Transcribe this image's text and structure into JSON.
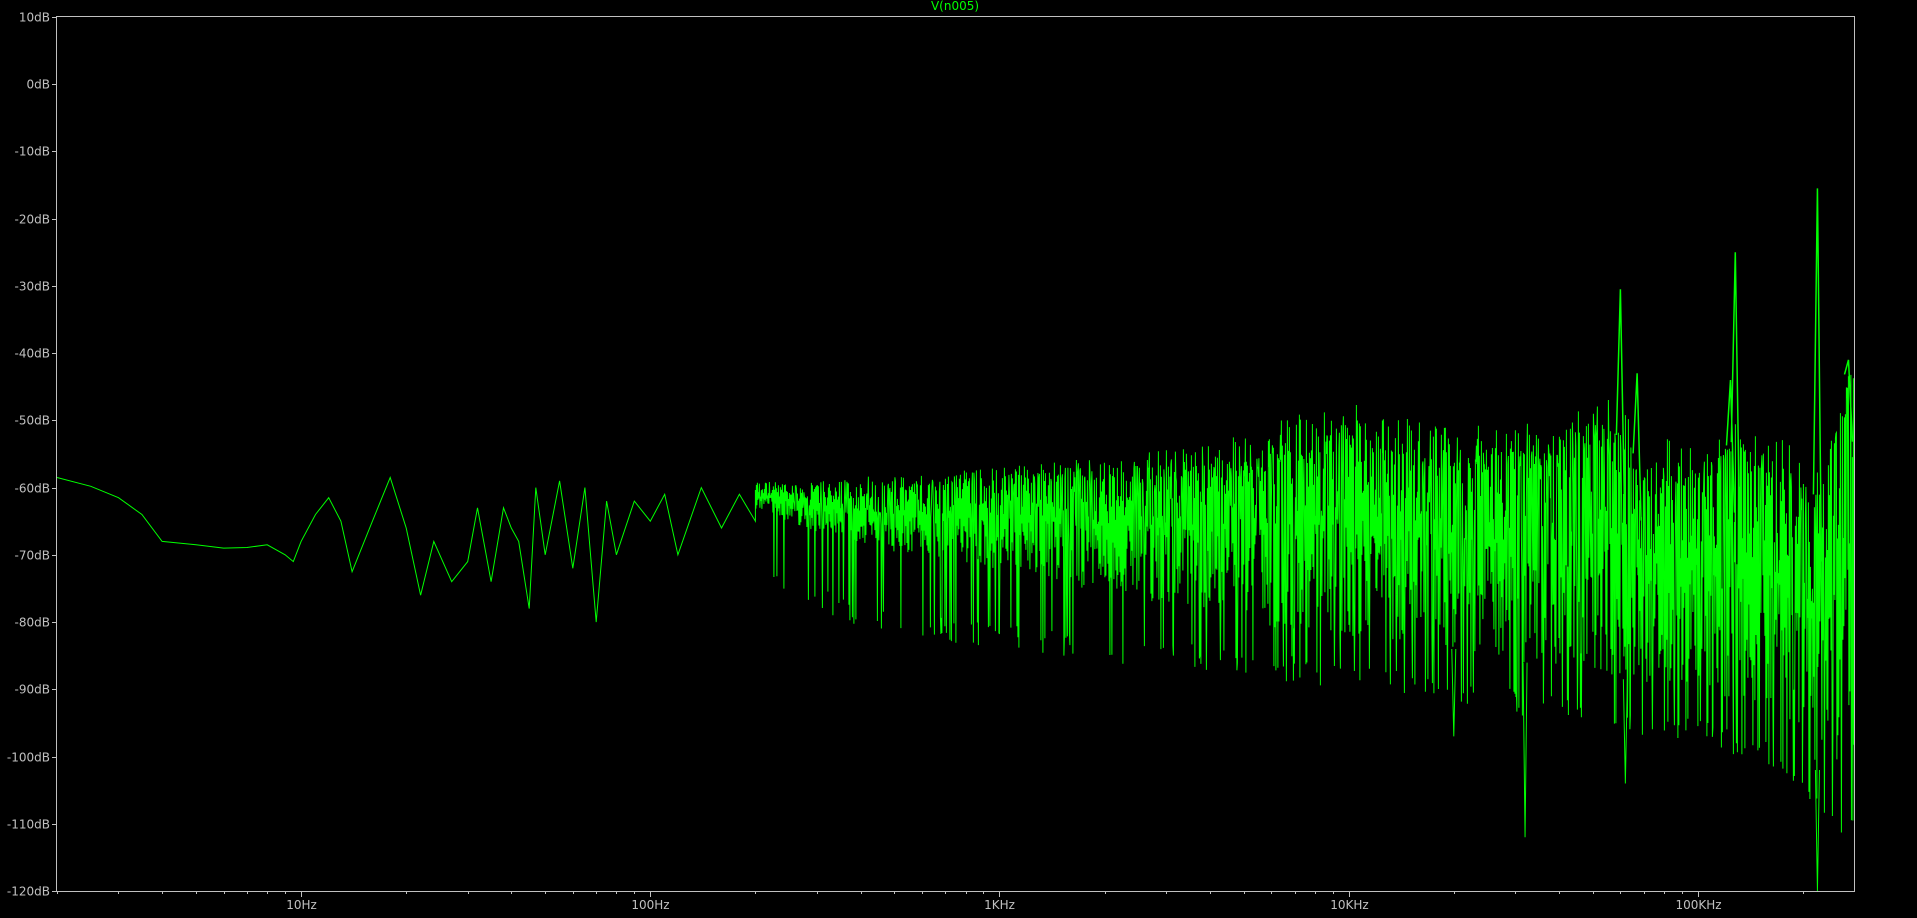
{
  "chart_data": {
    "type": "line",
    "title": "V(n005)",
    "xlabel": "",
    "ylabel": "",
    "x_scale": "log",
    "xlim": [
      2,
      280000
    ],
    "ylim": [
      -120,
      10
    ],
    "x_ticks": [
      {
        "value": 10,
        "label": "10Hz"
      },
      {
        "value": 100,
        "label": "100Hz"
      },
      {
        "value": 1000,
        "label": "1KHz"
      },
      {
        "value": 10000,
        "label": "10KHz"
      },
      {
        "value": 100000,
        "label": "100KHz"
      }
    ],
    "y_ticks": [
      {
        "value": 10,
        "label": "10dB"
      },
      {
        "value": 0,
        "label": "0dB"
      },
      {
        "value": -10,
        "label": "-10dB"
      },
      {
        "value": -20,
        "label": "-20dB"
      },
      {
        "value": -30,
        "label": "-30dB"
      },
      {
        "value": -40,
        "label": "-40dB"
      },
      {
        "value": -50,
        "label": "-50dB"
      },
      {
        "value": -60,
        "label": "-60dB"
      },
      {
        "value": -70,
        "label": "-70dB"
      },
      {
        "value": -80,
        "label": "-80dB"
      },
      {
        "value": -90,
        "label": "-90dB"
      },
      {
        "value": -100,
        "label": "-100dB"
      },
      {
        "value": -110,
        "label": "-110dB"
      },
      {
        "value": -120,
        "label": "-120dB"
      }
    ],
    "grid": false,
    "colors": {
      "background": "#000000",
      "axis": "#c0c0c0",
      "trace": "#00ff00",
      "title": "#00ff00"
    },
    "series": [
      {
        "x": [
          2,
          2.5,
          3,
          3.5,
          4,
          5,
          6,
          7,
          8,
          9,
          9.5,
          10,
          11,
          12,
          13,
          14,
          16,
          18,
          20,
          22,
          24,
          27,
          30,
          32,
          35,
          38,
          40,
          42,
          45,
          47,
          50,
          55,
          60,
          65,
          70,
          75,
          80,
          90,
          100,
          110,
          120,
          140,
          160,
          180,
          200
        ],
        "values": [
          -58.5,
          -59.8,
          -61.5,
          -64,
          -68,
          -68.5,
          -69,
          -68.9,
          -68.5,
          -70,
          -71,
          -68,
          -64,
          -61.5,
          -65,
          -72.5,
          -65,
          -58.5,
          -66,
          -76,
          -68,
          -74,
          -71,
          -63,
          -74,
          -63,
          -66,
          -68,
          -78,
          -60,
          -70,
          -59,
          -72,
          -60,
          -80,
          -62,
          -70,
          -62,
          -65,
          -61,
          -70,
          -60,
          -66,
          -61,
          -65
        ],
        "envelope": {
          "x": [
            200,
            300,
            500,
            1000,
            2000,
            5000,
            10000,
            20000,
            40000,
            55000,
            70000,
            100000,
            130000,
            180000,
            220000,
            280000
          ],
          "upper": [
            -60,
            -59,
            -58,
            -57,
            -57,
            -56,
            -51,
            -55,
            -54,
            -50,
            -56,
            -57,
            -53,
            -57,
            -61,
            -40
          ],
          "lower": [
            -74,
            -79,
            -82,
            -84,
            -86,
            -88,
            -90,
            -92,
            -95,
            -96,
            -97,
            -98,
            -100,
            -103,
            -110,
            -112
          ]
        },
        "peaks": [
          {
            "x": 60000,
            "y": -30.5
          },
          {
            "x": 67000,
            "y": -43
          },
          {
            "x": 124000,
            "y": -44
          },
          {
            "x": 128000,
            "y": -25
          },
          {
            "x": 220000,
            "y": -15.5
          },
          {
            "x": 270000,
            "y": -41
          }
        ],
        "dips": [
          {
            "x": 20000,
            "y": -97
          },
          {
            "x": 32000,
            "y": -112
          },
          {
            "x": 62000,
            "y": -104
          },
          {
            "x": 220000,
            "y": -120
          }
        ]
      }
    ]
  }
}
